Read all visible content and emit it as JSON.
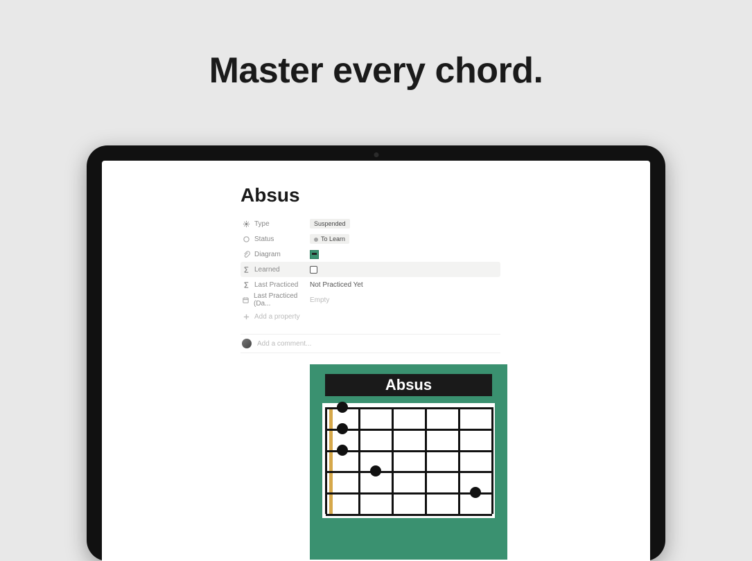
{
  "headline": "Master every chord.",
  "page": {
    "title": "Absus",
    "properties": [
      {
        "icon": "gear",
        "label": "Type",
        "value_type": "tag",
        "value": "Suspended"
      },
      {
        "icon": "circle",
        "label": "Status",
        "value_type": "tag_dot",
        "value": "To Learn"
      },
      {
        "icon": "clip",
        "label": "Diagram",
        "value_type": "thumb",
        "value": ""
      },
      {
        "icon": "sigma",
        "label": "Learned",
        "value_type": "checkbox",
        "value": "false",
        "hover": true
      },
      {
        "icon": "sigma",
        "label": "Last Practiced",
        "value_type": "text",
        "value": "Not Practiced Yet"
      },
      {
        "icon": "calendar",
        "label": "Last Practiced (Da...",
        "value_type": "empty",
        "value": "Empty"
      }
    ],
    "add_property_label": "Add a property",
    "comment_placeholder": "Add a comment..."
  },
  "chord": {
    "name": "Absus",
    "strings": 6,
    "frets_shown": 5,
    "fingers": [
      {
        "string": 1,
        "fret": 1
      },
      {
        "string": 2,
        "fret": 1
      },
      {
        "string": 3,
        "fret": 1
      },
      {
        "string": 4,
        "fret": 2
      },
      {
        "string": 5,
        "fret": 5
      }
    ]
  }
}
